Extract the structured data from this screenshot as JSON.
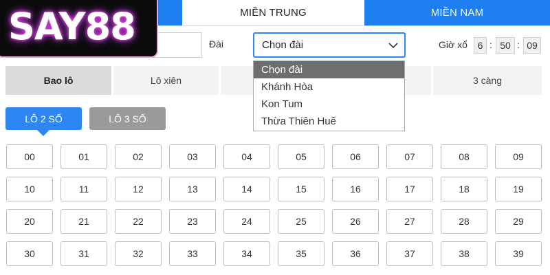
{
  "logo": {
    "text": "SAY88"
  },
  "region_tabs": [
    {
      "label": ""
    },
    {
      "label": "MIỀN TRUNG",
      "active": true
    },
    {
      "label": "MIỀN NAM"
    }
  ],
  "filter": {
    "dai_label": "Đài",
    "select_value": "Chọn đài",
    "dropdown_options": [
      "Chọn đài",
      "Khánh Hòa",
      "Kon Tum",
      "Thừa Thiên Huế"
    ],
    "selected_option": "Chọn đài",
    "draw_time_label": "Giờ xổ",
    "draw_time": {
      "hours": "6",
      "minutes": "50",
      "seconds": "09"
    }
  },
  "bet_types": [
    {
      "label": "Bao lô",
      "active": true
    },
    {
      "label": "Lô xiên"
    },
    {
      "label": ""
    },
    {
      "label": ""
    },
    {
      "label": "3 càng"
    }
  ],
  "lo_tabs": {
    "two_digit": "LÔ 2 SỐ",
    "three_digit": "LÔ 3 SỐ",
    "active": "two_digit"
  },
  "numbers": [
    "00",
    "01",
    "02",
    "03",
    "04",
    "05",
    "06",
    "07",
    "08",
    "09",
    "10",
    "11",
    "12",
    "13",
    "14",
    "15",
    "16",
    "17",
    "18",
    "19",
    "20",
    "21",
    "22",
    "23",
    "24",
    "25",
    "26",
    "27",
    "28",
    "29",
    "30",
    "31",
    "32",
    "33",
    "34",
    "35",
    "36",
    "37",
    "38",
    "39"
  ],
  "colors": {
    "primary_blue": "#2e86f2",
    "tab_blue": "#1e7ff0",
    "inactive_gray": "#9a9a9a",
    "selected_option_bg": "#6e6e6e"
  },
  "icons": {
    "select_arrow": "chevron-down-icon"
  }
}
